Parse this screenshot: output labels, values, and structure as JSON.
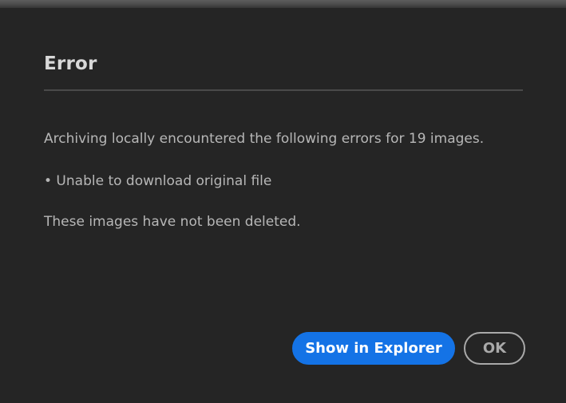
{
  "dialog": {
    "title": "Error",
    "message_lines": [
      "Archiving locally encountered the following errors for 19 images.",
      "• Unable to download original file",
      "These images have not been deleted."
    ],
    "buttons": {
      "show_in_explorer": "Show in Explorer",
      "ok": "OK"
    }
  },
  "colors": {
    "accent": "#1473e6",
    "dialog_background": "#252525",
    "title_text": "#d8d8d8",
    "body_text": "#b7b7b7",
    "secondary_button_border": "#a9a9a9"
  }
}
